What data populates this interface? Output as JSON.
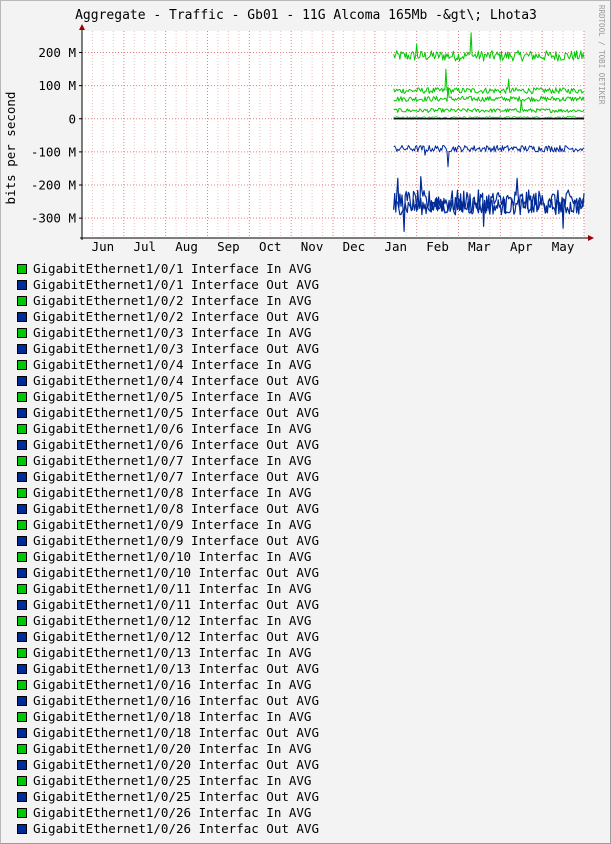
{
  "chart_data": {
    "type": "line",
    "title": "Aggregate - Traffic - Gb01 - 11G Alcoma 165Mb -&gt\\; Lhota3",
    "ylabel": "bits per second",
    "watermark": "RRDTOOL / TOBI OETIKER",
    "x_ticks": [
      "Jun",
      "Jul",
      "Aug",
      "Sep",
      "Oct",
      "Nov",
      "Dec",
      "Jan",
      "Feb",
      "Mar",
      "Apr",
      "May"
    ],
    "y_ticks": [
      {
        "value": 200000000,
        "label": "200 M"
      },
      {
        "value": 100000000,
        "label": "100 M"
      },
      {
        "value": 0,
        "label": "0"
      },
      {
        "value": -100000000,
        "label": "-100 M"
      },
      {
        "value": -200000000,
        "label": "-200 M"
      },
      {
        "value": -300000000,
        "label": "-300 M"
      }
    ],
    "ylim": [
      -360000000,
      265000000
    ],
    "xlim": [
      0,
      12
    ],
    "grid": true,
    "colors": {
      "in": "#00c800",
      "out": "#002a97"
    },
    "series": [
      {
        "name": "GigabitEthernet1/0/1 Interface In AVG",
        "dir": "in"
      },
      {
        "name": "GigabitEthernet1/0/1 Interface Out AVG",
        "dir": "out"
      },
      {
        "name": "GigabitEthernet1/0/2 Interface In AVG",
        "dir": "in"
      },
      {
        "name": "GigabitEthernet1/0/2 Interface Out AVG",
        "dir": "out"
      },
      {
        "name": "GigabitEthernet1/0/3 Interface In AVG",
        "dir": "in"
      },
      {
        "name": "GigabitEthernet1/0/3 Interface Out AVG",
        "dir": "out"
      },
      {
        "name": "GigabitEthernet1/0/4 Interface In AVG",
        "dir": "in"
      },
      {
        "name": "GigabitEthernet1/0/4 Interface Out AVG",
        "dir": "out"
      },
      {
        "name": "GigabitEthernet1/0/5 Interface In AVG",
        "dir": "in"
      },
      {
        "name": "GigabitEthernet1/0/5 Interface Out AVG",
        "dir": "out"
      },
      {
        "name": "GigabitEthernet1/0/6 Interface In AVG",
        "dir": "in"
      },
      {
        "name": "GigabitEthernet1/0/6 Interface Out AVG",
        "dir": "out"
      },
      {
        "name": "GigabitEthernet1/0/7 Interface In AVG",
        "dir": "in"
      },
      {
        "name": "GigabitEthernet1/0/7 Interface Out AVG",
        "dir": "out"
      },
      {
        "name": "GigabitEthernet1/0/8 Interface In AVG",
        "dir": "in"
      },
      {
        "name": "GigabitEthernet1/0/8 Interface Out AVG",
        "dir": "out"
      },
      {
        "name": "GigabitEthernet1/0/9 Interface In AVG",
        "dir": "in"
      },
      {
        "name": "GigabitEthernet1/0/9 Interface Out AVG",
        "dir": "out"
      },
      {
        "name": "GigabitEthernet1/0/10 Interfac In AVG",
        "dir": "in"
      },
      {
        "name": "GigabitEthernet1/0/10 Interfac Out AVG",
        "dir": "out"
      },
      {
        "name": "GigabitEthernet1/0/11 Interfac In AVG",
        "dir": "in"
      },
      {
        "name": "GigabitEthernet1/0/11 Interfac Out AVG",
        "dir": "out"
      },
      {
        "name": "GigabitEthernet1/0/12 Interfac In AVG",
        "dir": "in"
      },
      {
        "name": "GigabitEthernet1/0/12 Interfac Out AVG",
        "dir": "out"
      },
      {
        "name": "GigabitEthernet1/0/13 Interfac In AVG",
        "dir": "in"
      },
      {
        "name": "GigabitEthernet1/0/13 Interfac Out AVG",
        "dir": "out"
      },
      {
        "name": "GigabitEthernet1/0/16 Interfac In AVG",
        "dir": "in"
      },
      {
        "name": "GigabitEthernet1/0/16 Interfac Out AVG",
        "dir": "out"
      },
      {
        "name": "GigabitEthernet1/0/18 Interfac In AVG",
        "dir": "in"
      },
      {
        "name": "GigabitEthernet1/0/18 Interfac Out AVG",
        "dir": "out"
      },
      {
        "name": "GigabitEthernet1/0/20 Interfac In AVG",
        "dir": "in"
      },
      {
        "name": "GigabitEthernet1/0/20 Interfac Out AVG",
        "dir": "out"
      },
      {
        "name": "GigabitEthernet1/0/25 Interfac In AVG",
        "dir": "in"
      },
      {
        "name": "GigabitEthernet1/0/25 Interfac Out AVG",
        "dir": "out"
      },
      {
        "name": "GigabitEthernet1/0/26 Interfac In AVG",
        "dir": "in"
      },
      {
        "name": "GigabitEthernet1/0/26 Interfac Out AVG",
        "dir": "out"
      }
    ],
    "traces": [
      {
        "dir": "in",
        "start": 7.45,
        "end": 12,
        "mean": 190000000,
        "amp": 16000000,
        "spikes": [
          [
            9.3,
            260000000
          ],
          [
            8.0,
            225000000
          ]
        ]
      },
      {
        "dir": "in",
        "start": 7.45,
        "end": 12,
        "mean": 85000000,
        "amp": 9000000,
        "spikes": [
          [
            8.7,
            150000000
          ],
          [
            10.2,
            120000000
          ]
        ]
      },
      {
        "dir": "in",
        "start": 7.45,
        "end": 12,
        "mean": 60000000,
        "amp": 8000000,
        "spikes": [
          [
            8.75,
            95000000
          ]
        ]
      },
      {
        "dir": "in",
        "start": 7.45,
        "end": 12,
        "mean": 25000000,
        "amp": 6000000,
        "spikes": [
          [
            10.5,
            55000000
          ]
        ]
      },
      {
        "dir": "in",
        "start": 7.45,
        "end": 12,
        "mean": 4000000,
        "amp": 2500000,
        "spikes": []
      },
      {
        "dir": "out",
        "start": 7.45,
        "end": 12,
        "mean": 0,
        "amp": 1000000,
        "spikes": []
      },
      {
        "dir": "out",
        "start": 7.45,
        "end": 12,
        "mean": -90000000,
        "amp": 10000000,
        "spikes": [
          [
            8.75,
            -145000000
          ],
          [
            8.2,
            -110000000
          ]
        ]
      },
      {
        "dir": "out",
        "start": 7.45,
        "end": 12,
        "mean": -250000000,
        "amp": 35000000,
        "spikes": [
          [
            7.55,
            -180000000
          ],
          [
            7.7,
            -340000000
          ],
          [
            8.1,
            -175000000
          ],
          [
            9.6,
            -325000000
          ],
          [
            10.4,
            -180000000
          ],
          [
            11.5,
            -330000000
          ]
        ]
      },
      {
        "dir": "out",
        "start": 7.45,
        "end": 12,
        "mean": -265000000,
        "amp": 25000000,
        "spikes": []
      }
    ]
  }
}
